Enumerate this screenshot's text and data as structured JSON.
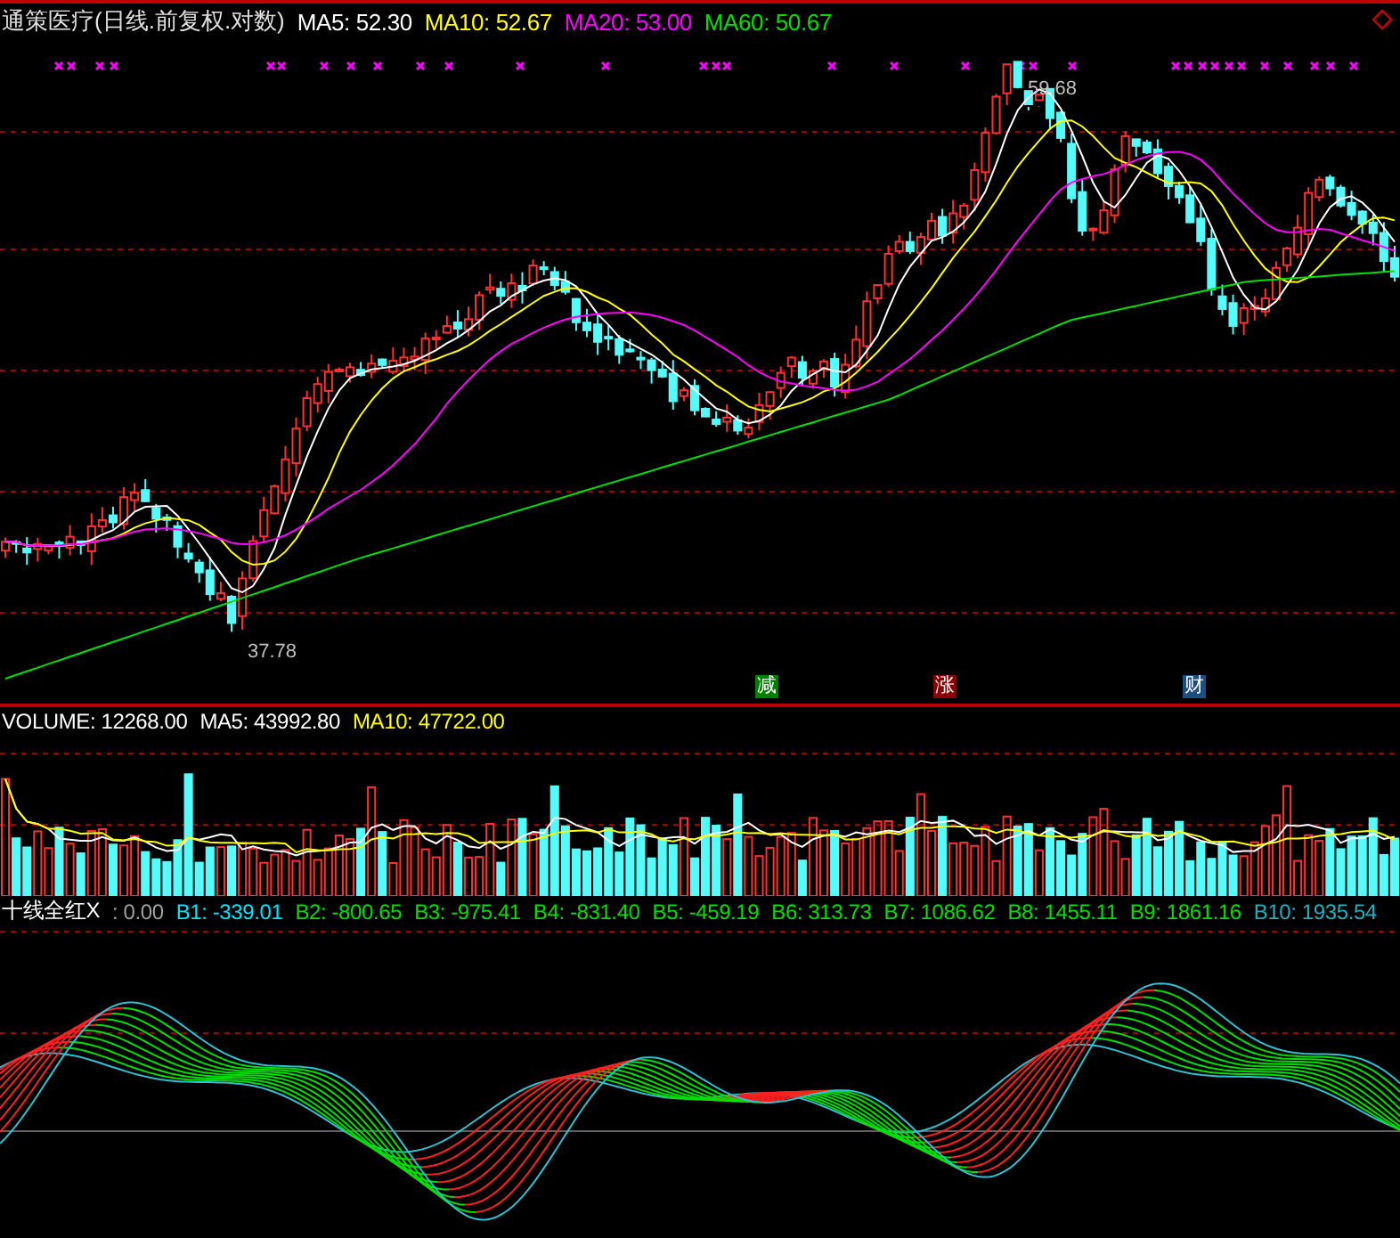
{
  "price_panel": {
    "title": "通策医疗(日线.前复权.对数)",
    "legend": [
      {
        "text": "MA5: 52.30",
        "color": "#ffffff"
      },
      {
        "text": "MA10: 52.67",
        "color": "#ffff00"
      },
      {
        "text": "MA20: 53.00",
        "color": "#ff00ff"
      },
      {
        "text": "MA60: 50.67",
        "color": "#00e000"
      }
    ],
    "high_label": "59.68",
    "low_label": "37.78",
    "event_badges": [
      {
        "text": "减",
        "color": "#008000"
      },
      {
        "text": "涨",
        "color": "#8b0000"
      },
      {
        "text": "财",
        "color": "#1c4e80"
      }
    ]
  },
  "volume_panel": {
    "legend": [
      {
        "text": "VOLUME: 12268.00",
        "color": "#ffffff"
      },
      {
        "text": "MA5: 43992.80",
        "color": "#ffffff"
      },
      {
        "text": "MA10: 47722.00",
        "color": "#ffff00"
      }
    ]
  },
  "indicator_panel": {
    "legend": [
      {
        "text": "十线全红X",
        "color": "#ffffff"
      },
      {
        "text": ": 0.00",
        "color": "#a0a0a0"
      },
      {
        "text": "B1: -339.01",
        "color": "#00e5ff"
      },
      {
        "text": "B2: -800.65",
        "color": "#00e000"
      },
      {
        "text": "B3: -975.41",
        "color": "#00e000"
      },
      {
        "text": "B4: -831.40",
        "color": "#00e000"
      },
      {
        "text": "B5: -459.19",
        "color": "#00e000"
      },
      {
        "text": "B6: 313.73",
        "color": "#00e000"
      },
      {
        "text": "B7: 1086.62",
        "color": "#00e000"
      },
      {
        "text": "B8: 1455.11",
        "color": "#00e000"
      },
      {
        "text": "B9: 1861.16",
        "color": "#00e000"
      },
      {
        "text": "B10: 1935.54",
        "color": "#20b0c0"
      }
    ]
  }
}
